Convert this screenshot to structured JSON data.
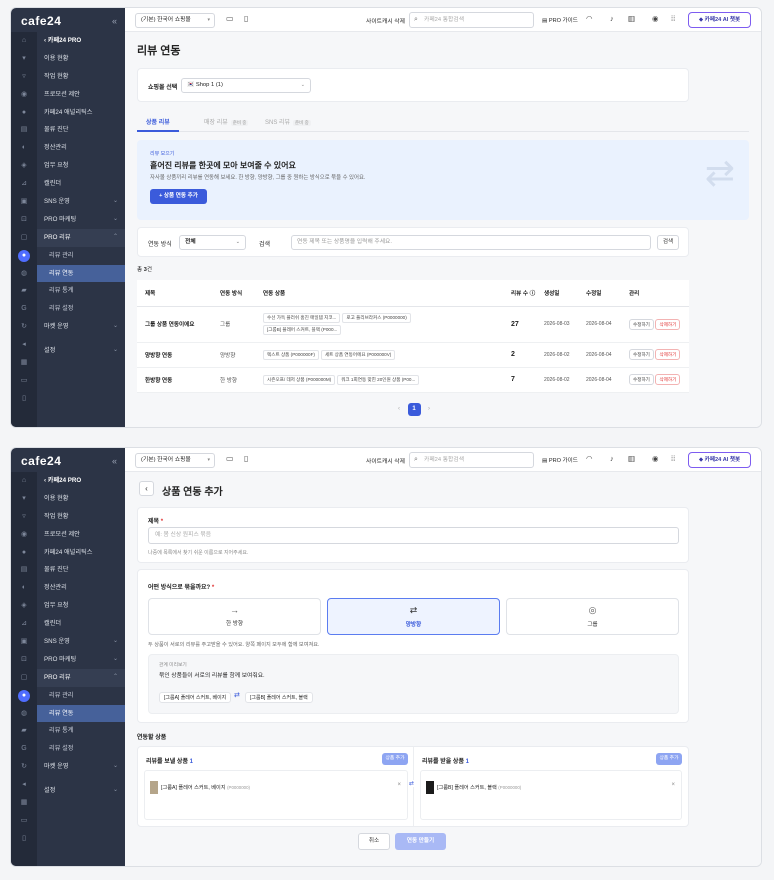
{
  "brand": {
    "logo": "cafe24",
    "collapse": "«"
  },
  "topbar": {
    "mall_select": "(기본) 한국어 쇼핑몰",
    "cache_delete": "사이트캐시 삭제",
    "search_placeholder": "카페24 통합검색",
    "pro_guide": "PRO 가이드",
    "ai_chat": "카페24 AI 챗봇"
  },
  "sidebar": {
    "back": "카페24 PRO",
    "items": [
      "이용 현황",
      "작업 현황",
      "프로모션 제안",
      "카페24 애널리틱스",
      "물류 진단",
      "정산관리",
      "업무 요청",
      "캘린더",
      "SNS 운영",
      "PRO 마케팅",
      "PRO 리뷰",
      "리뷰 관리",
      "리뷰 연동",
      "리뷰 통계",
      "리뷰 설정",
      "마켓 운영",
      "설정"
    ]
  },
  "screen1": {
    "title": "리뷰 연동",
    "mall_label": "쇼핑몰 선택",
    "mall_value": "Shop 1 (1)",
    "tabs": [
      {
        "label": "상품 리뷰"
      },
      {
        "label": "매장 리뷰",
        "badge": "준비 중"
      },
      {
        "label": "SNS 리뷰",
        "badge": "준비 중"
      }
    ],
    "banner": {
      "tag": "리뷰 모으기",
      "headline": "흩어진 리뷰를 한곳에 모아 보여줄 수 있어요",
      "desc": "자사몰 상품끼리 리뷰를 연동해 보세요. 한 방향, 양방향, 그룹 중 원하는 방식으로 묶을 수 있어요.",
      "button": "+ 상품 연동 추가"
    },
    "filter": {
      "method_label": "연동 방식",
      "method_value": "전체",
      "search_label": "검색",
      "search_placeholder": "연동 제목 또는 상품명을 입력해 주세요.",
      "search_button": "검색"
    },
    "count_prefix": "총 ",
    "count_value": "3",
    "count_suffix": "건",
    "columns": [
      "제목",
      "연동 방식",
      "연동 상품",
      "리뷰 수",
      "생성일",
      "수정일",
      "관리"
    ],
    "rows": [
      {
        "title": "그룹 상품 연동이에요",
        "method": "그룹",
        "products": [
          "수선 가득 플러쉬 홈진 매일템 지코...",
          "로고 플리브라커스 (P0000000)",
          "[그룹B] 플레어 스커트, 블랙 (P000..."
        ],
        "reviews": "27",
        "created": "2026-08-03",
        "updated": "2026-08-04"
      },
      {
        "title": "양방향 연동",
        "method": "양방향",
        "products": [
          "렉스트 상품 (P000000F)",
          "세트 상품 연동어에요 (P000000V)"
        ],
        "reviews": "2",
        "created": "2026-08-02",
        "updated": "2026-08-04"
      },
      {
        "title": "한방향 연동",
        "method": "한 방향",
        "products": [
          "시즌오프/ 데저 상품 (P000000M)",
          "워크 1회연동 맞힌 20인원 상품 (P00..."
        ],
        "reviews": "7",
        "created": "2026-08-02",
        "updated": "2026-08-04"
      }
    ],
    "edit_label": "수정하기",
    "delete_label": "삭제하기",
    "pager": {
      "prev": "‹",
      "page": "1",
      "next": "›"
    }
  },
  "screen2": {
    "title": "상품 연동 추가",
    "back": "‹",
    "name_label": "제목",
    "required": "*",
    "name_placeholder": "예: 봄 신상 원피스 묶음",
    "name_help": "나중에 목록에서 찾기 쉬운 이름으로 지어주세요.",
    "mode_label": "어떤 방식으로 묶을까요?",
    "modes": [
      {
        "icon": "→",
        "label": "한 방향"
      },
      {
        "icon": "⇄",
        "label": "양방향"
      },
      {
        "icon": "◎",
        "label": "그룹"
      }
    ],
    "mode_desc": "두 상품이 서로의 리뷰를 주고받을 수 있어요. 양쪽 페이지 모두에 함께 보여져요.",
    "preview_title": "관계 미리보기",
    "preview_desc": "묶인 상품들이 서로의 리뷰를 함께 보여줘요.",
    "preview_a": "[그룹A] 플레어 스커트, 베이지",
    "preview_arrow": "⇄",
    "preview_b": "[그룹B] 플레어 스커트, 블랙",
    "linked_label": "연동할 상품",
    "send": {
      "label": "리뷰를 보낼 상품",
      "count": "1",
      "add": "상품 추가",
      "item": "[그룹A] 플레어 스커트, 베이지",
      "code": "(P0000000)"
    },
    "recv": {
      "label": "리뷰를 받을 상품",
      "count": "1",
      "add": "상품 추가",
      "item": "[그룹B] 플레어 스커트, 블랙",
      "code": "(P0000000)"
    },
    "remove": "×",
    "cancel": "취소",
    "submit": "연동 만들기"
  },
  "colors": {
    "accent": "#3b5bdb",
    "sidebar": "#2c3446",
    "danger": "#e03131",
    "beige": "#b5a58a",
    "black": "#1b1b1b"
  }
}
